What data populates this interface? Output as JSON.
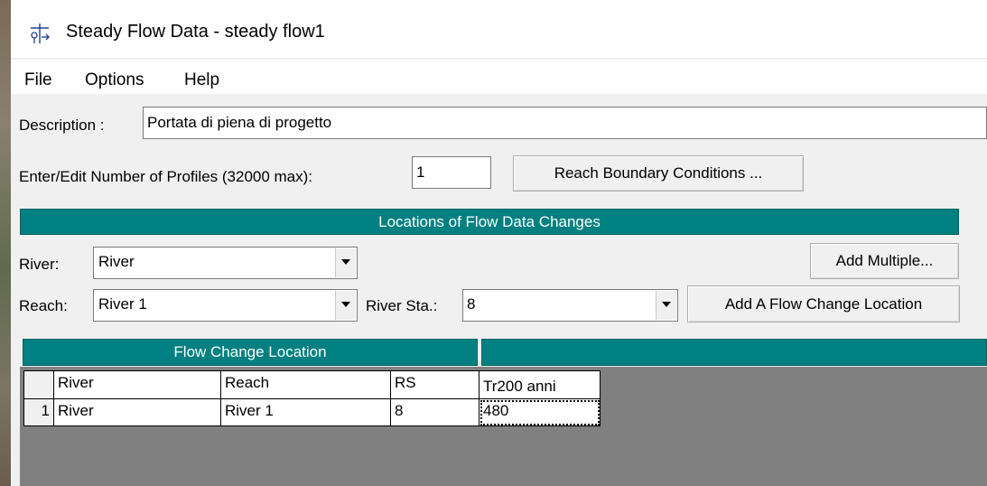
{
  "window": {
    "title": "Steady Flow Data - steady flow1",
    "icon": "flow-data-icon"
  },
  "menu": [
    "File",
    "Options",
    "Help"
  ],
  "description": {
    "label": "Description :",
    "value": "Portata di piena di progetto"
  },
  "profiles": {
    "label": "Enter/Edit Number of Profiles (32000 max):",
    "value": "1"
  },
  "buttons": {
    "reach_boundary": "Reach Boundary Conditions ...",
    "add_multiple": "Add Multiple...",
    "add_flow_change": "Add A Flow Change Location"
  },
  "locations_banner": "Locations of Flow Data Changes",
  "selectors": {
    "river_label": "River:",
    "river_value": "River",
    "reach_label": "Reach:",
    "reach_value": "River 1",
    "station_label": "River Sta.:",
    "station_value": "8"
  },
  "table": {
    "group_header": "Flow Change Location",
    "columns": [
      "River",
      "Reach",
      "RS",
      "Tr200 anni"
    ],
    "rows": [
      {
        "num": "1",
        "river": "River",
        "reach": "River 1",
        "rs": "8",
        "flow": "480"
      }
    ]
  },
  "colors": {
    "teal_header": "#008080",
    "grid_background": "#808080"
  }
}
